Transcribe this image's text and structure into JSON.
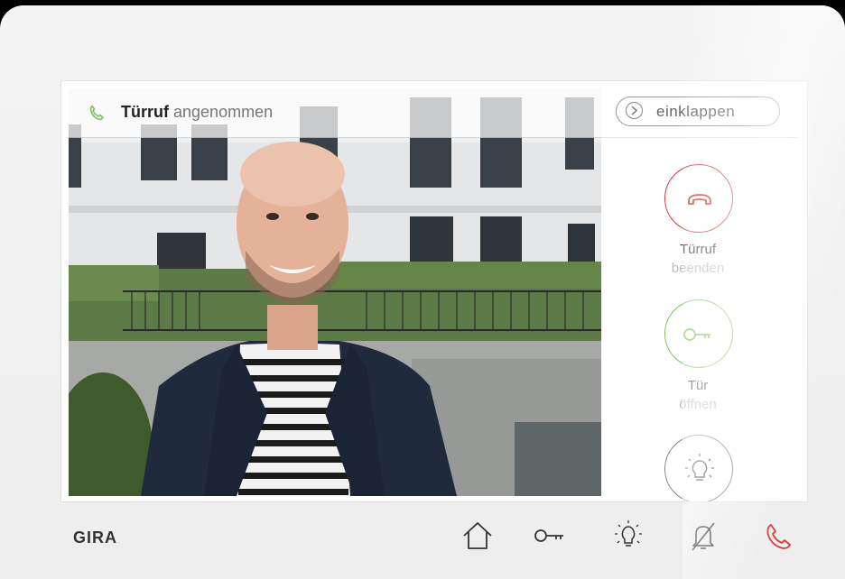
{
  "brand": {
    "name": "GIRA"
  },
  "call_status": {
    "title": "Türruf",
    "state": "angenommen"
  },
  "panel": {
    "collapse_label": "einklappen"
  },
  "actions": [
    {
      "line1": "Türruf",
      "line2": "beenden",
      "icon": "end-call-icon",
      "color": "#d63a3a"
    },
    {
      "line1": "Tür",
      "line2": "öffnen",
      "icon": "key-icon",
      "color": "#7cc25a"
    },
    {
      "line1": "",
      "line2": "",
      "icon": "light-bulb-icon",
      "color": "#555555"
    }
  ],
  "nav": [
    "home-icon",
    "key-icon",
    "light-bulb-icon",
    "bell-muted-icon",
    "phone-icon"
  ],
  "colors": {
    "accent_green": "#7cc25a",
    "accent_red": "#d63a3a"
  }
}
